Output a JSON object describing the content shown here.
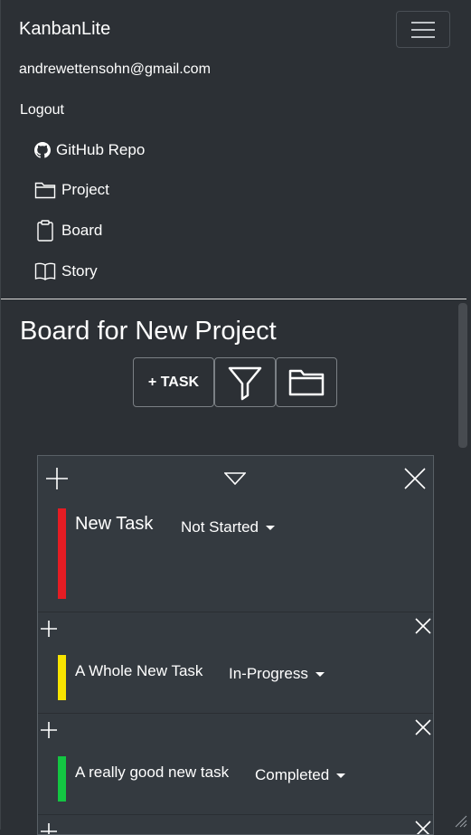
{
  "app": {
    "brand": "KanbanLite"
  },
  "nav": {
    "email": "andrewettensohn@gmail.com",
    "logout": "Logout",
    "links": [
      {
        "label": "GitHub Repo",
        "icon": "github-icon"
      },
      {
        "label": "Project",
        "icon": "folder-icon"
      },
      {
        "label": "Board",
        "icon": "clipboard-icon"
      },
      {
        "label": "Story",
        "icon": "book-icon"
      }
    ]
  },
  "page": {
    "title": "Board for New Project"
  },
  "toolbar": {
    "add_task_label": "+ TASK"
  },
  "tasks": [
    {
      "name": "New Task",
      "status": "Not Started",
      "color": "#e51c23"
    },
    {
      "name": "A Whole New Task",
      "status": "In-Progress",
      "color": "#f8e400"
    },
    {
      "name": "A really good new task",
      "status": "Completed",
      "color": "#13c542"
    }
  ]
}
